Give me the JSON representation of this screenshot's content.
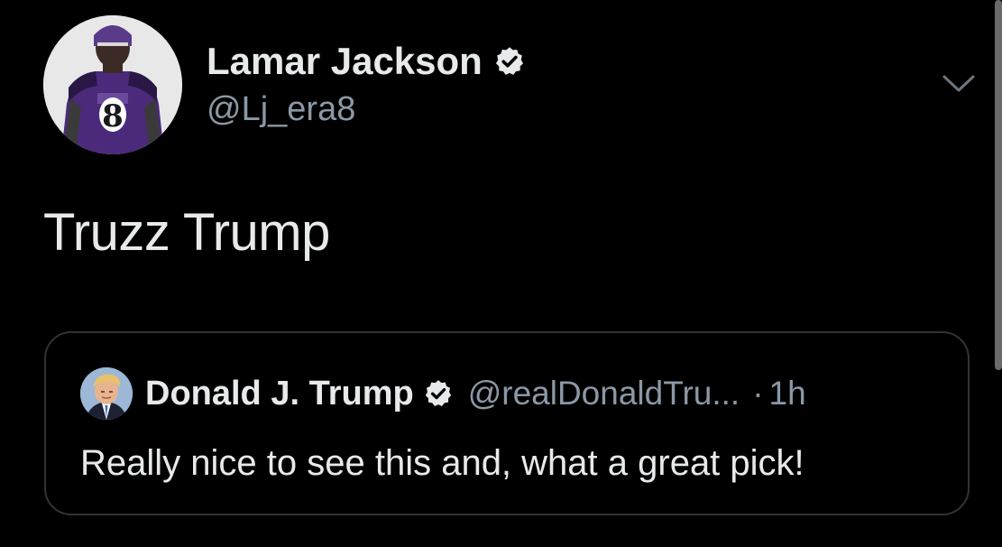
{
  "tweet": {
    "author_name": "Lamar Jackson",
    "author_handle": "@Lj_era8",
    "text": "Truzz Trump",
    "avatar_icon": "player-avatar",
    "verified": true
  },
  "quoted_tweet": {
    "author_name": "Donald J. Trump",
    "author_handle": "@realDonaldTru...",
    "separator": "·",
    "time": "1h",
    "text": "Really nice to see this and, what a great pick!",
    "avatar_icon": "user-avatar",
    "verified": true
  },
  "icons": {
    "verified": "verified-badge-icon",
    "more_options": "chevron-down-icon"
  },
  "colors": {
    "background": "#000000",
    "primary_text": "#e7e9ea",
    "secondary_text": "#8b98a5",
    "border": "#2f3336",
    "jersey_purple": "#4b2a7b"
  }
}
